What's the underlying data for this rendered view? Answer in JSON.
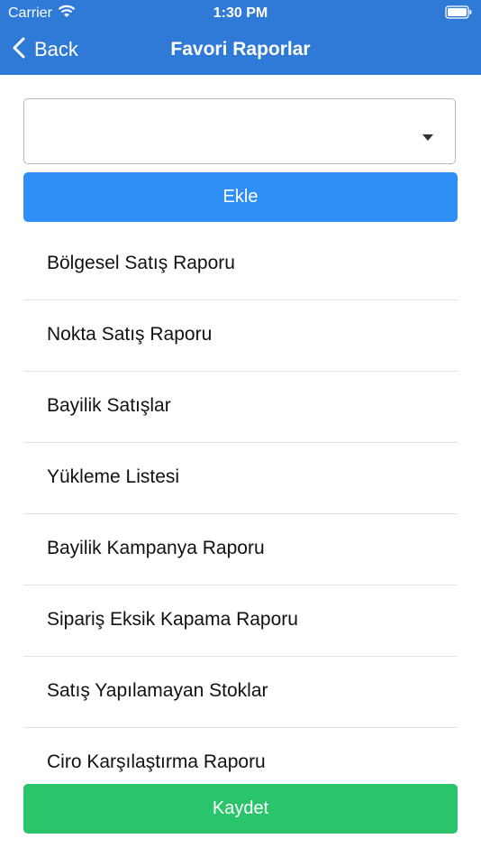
{
  "status_bar": {
    "carrier": "Carrier",
    "time": "1:30 PM",
    "wifi_icon": "wifi-icon",
    "battery_icon": "battery-icon"
  },
  "nav": {
    "back_label": "Back",
    "title": "Favori Raporlar",
    "back_icon": "chevron-left-icon"
  },
  "dropdown": {
    "selected": "",
    "icon": "caret-down-icon"
  },
  "add_button_label": "Ekle",
  "reports": [
    "Bölgesel Satış Raporu",
    "Nokta Satış Raporu",
    "Bayilik Satışlar",
    "Yükleme Listesi",
    "Bayilik Kampanya Raporu",
    "Sipariş Eksik Kapama Raporu",
    "Satış Yapılamayan Stoklar",
    "Ciro Karşılaştırma Raporu"
  ],
  "save_button_label": "Kaydet",
  "colors": {
    "header": "#2f7ad6",
    "add_button": "#2f8ff7",
    "save_button": "#2ac46a"
  }
}
